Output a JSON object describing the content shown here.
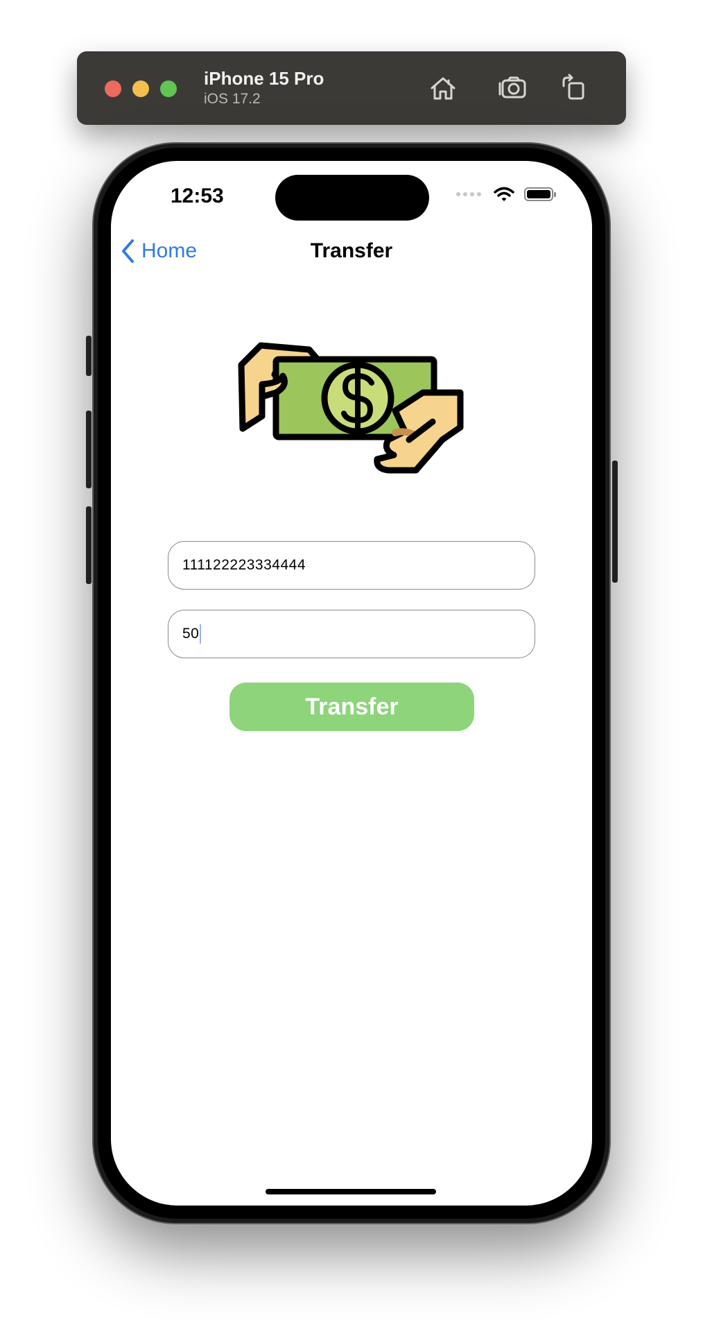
{
  "simulator": {
    "device_name": "iPhone 15 Pro",
    "os_version": "iOS 17.2"
  },
  "status_bar": {
    "time": "12:53"
  },
  "nav": {
    "back_label": "Home",
    "title": "Transfer"
  },
  "form": {
    "account_value": "111122223334444",
    "amount_value": "50",
    "submit_label": "Transfer"
  },
  "colors": {
    "accent_blue": "#2f7ae5",
    "button_green": "#8dd47b"
  }
}
